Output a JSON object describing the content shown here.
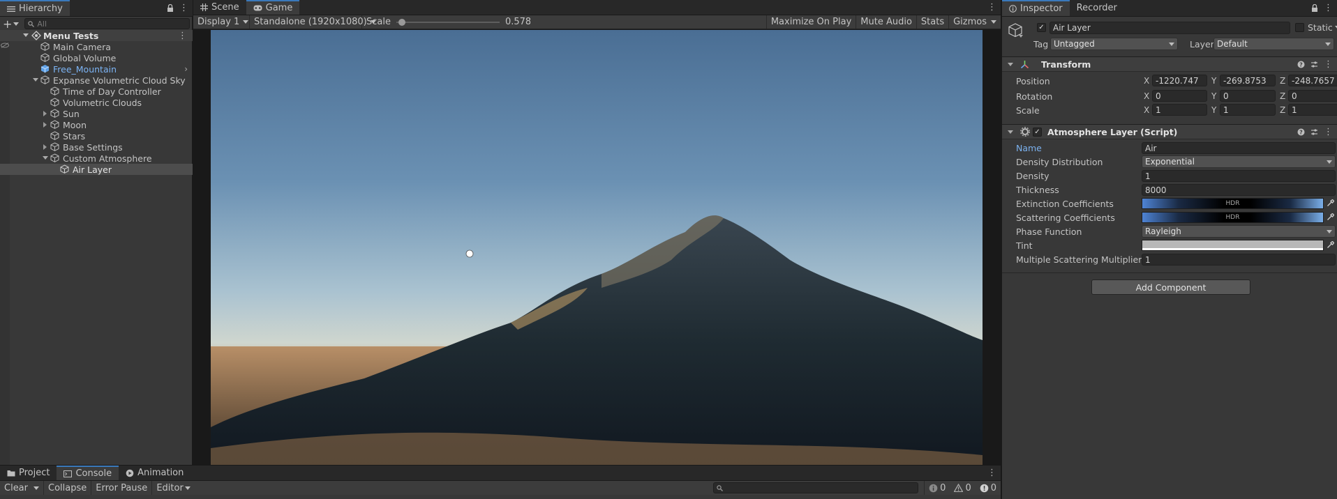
{
  "hierarchy": {
    "tab_label": "Hierarchy",
    "search_placeholder": "All",
    "scene_name": "Menu Tests",
    "items": [
      {
        "label": "Main Camera"
      },
      {
        "label": "Global Volume"
      },
      {
        "label": "Free_Mountain"
      },
      {
        "label": "Expanse Volumetric Cloud Sky"
      },
      {
        "label": "Time of Day Controller"
      },
      {
        "label": "Volumetric Clouds"
      },
      {
        "label": "Sun"
      },
      {
        "label": "Moon"
      },
      {
        "label": "Stars"
      },
      {
        "label": "Base Settings"
      },
      {
        "label": "Custom Atmosphere"
      },
      {
        "label": "Air Layer"
      }
    ]
  },
  "game": {
    "tabs": [
      {
        "label": "Scene"
      },
      {
        "label": "Game"
      }
    ],
    "display": "Display 1",
    "resolution": "Standalone (1920x1080)",
    "scale_label": "Scale",
    "scale_value": "0.578x",
    "scale_fraction": 0.02,
    "toggles": {
      "maximize": "Maximize On Play",
      "mute": "Mute Audio",
      "stats": "Stats",
      "gizmos": "Gizmos"
    }
  },
  "inspector": {
    "tabs": [
      {
        "label": "Inspector"
      },
      {
        "label": "Recorder"
      }
    ],
    "object_name": "Air Layer",
    "static_label": "Static",
    "tag_label": "Tag",
    "tag_value": "Untagged",
    "layer_label": "Layer",
    "layer_value": "Default",
    "transform": {
      "title": "Transform",
      "position_label": "Position",
      "rotation_label": "Rotation",
      "scale_label": "Scale",
      "position": {
        "x": "-1220.747",
        "y": "-269.8753",
        "z": "-248.7657"
      },
      "rotation": {
        "x": "0",
        "y": "0",
        "z": "0"
      },
      "scale": {
        "x": "1",
        "y": "1",
        "z": "1"
      }
    },
    "atmosphere": {
      "title": "Atmosphere Layer (Script)",
      "name_label": "Name",
      "name_value": "Air",
      "density_distribution_label": "Density Distribution",
      "density_distribution_value": "Exponential",
      "density_label": "Density",
      "density_value": "1",
      "thickness_label": "Thickness",
      "thickness_value": "8000",
      "extinction_label": "Extinction Coefficients",
      "scattering_label": "Scattering Coefficients",
      "hdr_text": "HDR",
      "phase_label": "Phase Function",
      "phase_value": "Rayleigh",
      "tint_label": "Tint",
      "msm_label": "Multiple Scattering Multiplier",
      "msm_value": "1"
    },
    "add_component": "Add Component",
    "colors": {
      "accent_blue": "#3a79bb",
      "link_blue": "#7bb1ee",
      "prefab_blue": "#7cb4f5"
    }
  },
  "bottom": {
    "tabs": [
      {
        "label": "Project"
      },
      {
        "label": "Console"
      },
      {
        "label": "Animation"
      }
    ],
    "clear": "Clear",
    "collapse": "Collapse",
    "error_pause": "Error Pause",
    "editor": "Editor",
    "counts": {
      "info": "0",
      "warn": "0",
      "error": "0"
    }
  }
}
